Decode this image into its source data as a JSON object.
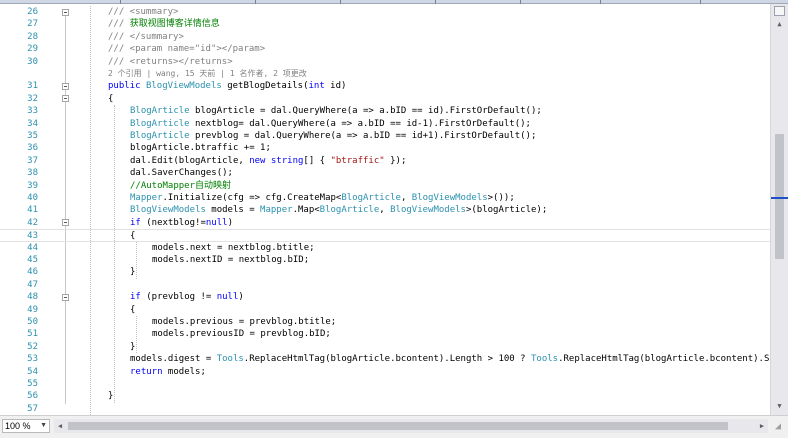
{
  "editor": {
    "lines": [
      {
        "n": "26",
        "indent": 0,
        "tokens": [
          [
            "xml",
            "/// <summary>"
          ]
        ]
      },
      {
        "n": "27",
        "indent": 0,
        "tokens": [
          [
            "xml",
            "/// "
          ],
          [
            "comment",
            "获取视图博客详情信息"
          ]
        ]
      },
      {
        "n": "28",
        "indent": 0,
        "tokens": [
          [
            "xml",
            "/// </summary>"
          ]
        ]
      },
      {
        "n": "29",
        "indent": 0,
        "tokens": [
          [
            "xml",
            "/// <param name=\"id\"></param>"
          ]
        ]
      },
      {
        "n": "30",
        "indent": 0,
        "tokens": [
          [
            "xml",
            "/// <returns></returns>"
          ]
        ]
      },
      {
        "n": "",
        "indent": 0,
        "codelens": "2 个引用 | wang, 15 天前 | 1 名作者, 2 项更改",
        "tokens": []
      },
      {
        "n": "31",
        "indent": 0,
        "tokens": [
          [
            "keyword",
            "public "
          ],
          [
            "type",
            "BlogViewModels"
          ],
          [
            "plain",
            " getBlogDetails("
          ],
          [
            "keyword",
            "int"
          ],
          [
            "plain",
            " id)"
          ]
        ]
      },
      {
        "n": "32",
        "indent": 0,
        "tokens": [
          [
            "plain",
            "{"
          ]
        ]
      },
      {
        "n": "33",
        "indent": 1,
        "tokens": [
          [
            "type",
            "BlogArticle"
          ],
          [
            "plain",
            " blogArticle = dal.QueryWhere(a => a.bID == id).FirstOrDefault();"
          ]
        ]
      },
      {
        "n": "34",
        "indent": 1,
        "tokens": [
          [
            "type",
            "BlogArticle"
          ],
          [
            "plain",
            " nextblog= dal.QueryWhere(a => a.bID == id-1).FirstOrDefault();"
          ]
        ]
      },
      {
        "n": "35",
        "indent": 1,
        "tokens": [
          [
            "type",
            "BlogArticle"
          ],
          [
            "plain",
            " prevblog = dal.QueryWhere(a => a.bID == id+1).FirstOrDefault();"
          ]
        ]
      },
      {
        "n": "36",
        "indent": 1,
        "tokens": [
          [
            "plain",
            "blogArticle.btraffic += 1;"
          ]
        ]
      },
      {
        "n": "37",
        "indent": 1,
        "tokens": [
          [
            "plain",
            "dal.Edit(blogArticle, "
          ],
          [
            "keyword",
            "new string"
          ],
          [
            "plain",
            "[] { "
          ],
          [
            "string",
            "\"btraffic\""
          ],
          [
            "plain",
            " });"
          ]
        ]
      },
      {
        "n": "38",
        "indent": 1,
        "tokens": [
          [
            "plain",
            "dal.SaverChanges();"
          ]
        ]
      },
      {
        "n": "39",
        "indent": 1,
        "tokens": [
          [
            "comment",
            "//AutoMapper自动映射"
          ]
        ]
      },
      {
        "n": "40",
        "indent": 1,
        "tokens": [
          [
            "type",
            "Mapper"
          ],
          [
            "plain",
            ".Initialize(cfg => cfg.CreateMap<"
          ],
          [
            "type",
            "BlogArticle"
          ],
          [
            "plain",
            ", "
          ],
          [
            "type",
            "BlogViewModels"
          ],
          [
            "plain",
            ">());"
          ]
        ]
      },
      {
        "n": "41",
        "indent": 1,
        "tokens": [
          [
            "type",
            "BlogViewModels"
          ],
          [
            "plain",
            " models = "
          ],
          [
            "type",
            "Mapper"
          ],
          [
            "plain",
            ".Map<"
          ],
          [
            "type",
            "BlogArticle"
          ],
          [
            "plain",
            ", "
          ],
          [
            "type",
            "BlogViewModels"
          ],
          [
            "plain",
            ">(blogArticle);"
          ]
        ]
      },
      {
        "n": "42",
        "indent": 1,
        "tokens": [
          [
            "keyword",
            "if"
          ],
          [
            "plain",
            " (nextblog!="
          ],
          [
            "keyword",
            "null"
          ],
          [
            "plain",
            ")"
          ]
        ]
      },
      {
        "n": "43",
        "indent": 1,
        "current": true,
        "tokens": [
          [
            "plain",
            "{"
          ]
        ]
      },
      {
        "n": "44",
        "indent": 2,
        "tokens": [
          [
            "plain",
            "models.next = nextblog.btitle;"
          ]
        ]
      },
      {
        "n": "45",
        "indent": 2,
        "tokens": [
          [
            "plain",
            "models.nextID = nextblog.bID;"
          ]
        ]
      },
      {
        "n": "46",
        "indent": 1,
        "tokens": [
          [
            "plain",
            "}"
          ]
        ]
      },
      {
        "n": "47",
        "indent": 0,
        "tokens": []
      },
      {
        "n": "48",
        "indent": 1,
        "tokens": [
          [
            "keyword",
            "if"
          ],
          [
            "plain",
            " (prevblog != "
          ],
          [
            "keyword",
            "null"
          ],
          [
            "plain",
            ")"
          ]
        ]
      },
      {
        "n": "49",
        "indent": 1,
        "tokens": [
          [
            "plain",
            "{"
          ]
        ]
      },
      {
        "n": "50",
        "indent": 2,
        "tokens": [
          [
            "plain",
            "models.previous = prevblog.btitle;"
          ]
        ]
      },
      {
        "n": "51",
        "indent": 2,
        "tokens": [
          [
            "plain",
            "models.previousID = prevblog.bID;"
          ]
        ]
      },
      {
        "n": "52",
        "indent": 1,
        "tokens": [
          [
            "plain",
            "}"
          ]
        ]
      },
      {
        "n": "53",
        "indent": 1,
        "tokens": [
          [
            "plain",
            "models.digest = "
          ],
          [
            "type",
            "Tools"
          ],
          [
            "plain",
            ".ReplaceHtmlTag(blogArticle.bcontent).Length > 100 ? "
          ],
          [
            "type",
            "Tools"
          ],
          [
            "plain",
            ".ReplaceHtmlTag(blogArticle.bcontent).S"
          ]
        ]
      },
      {
        "n": "54",
        "indent": 1,
        "tokens": [
          [
            "keyword",
            "return"
          ],
          [
            "plain",
            " models;"
          ]
        ]
      },
      {
        "n": "55",
        "indent": 0,
        "tokens": []
      },
      {
        "n": "56",
        "indent": 0,
        "tokens": [
          [
            "plain",
            "}"
          ]
        ]
      },
      {
        "n": "57",
        "indent": 0,
        "tokens": []
      }
    ]
  },
  "statusbar": {
    "zoom": "100 %"
  },
  "icons": {
    "scroll_up": "scroll-up-arrow-icon",
    "scroll_down": "scroll-down-arrow-icon",
    "scroll_left": "scroll-left-arrow-icon",
    "scroll_right": "scroll-right-arrow-icon",
    "collapse": "collapse-minus-icon"
  },
  "colors": {
    "line_number": "#2b91af",
    "comment": "#008000",
    "keyword": "#0000ff",
    "type": "#2b91af",
    "string": "#a31515"
  }
}
